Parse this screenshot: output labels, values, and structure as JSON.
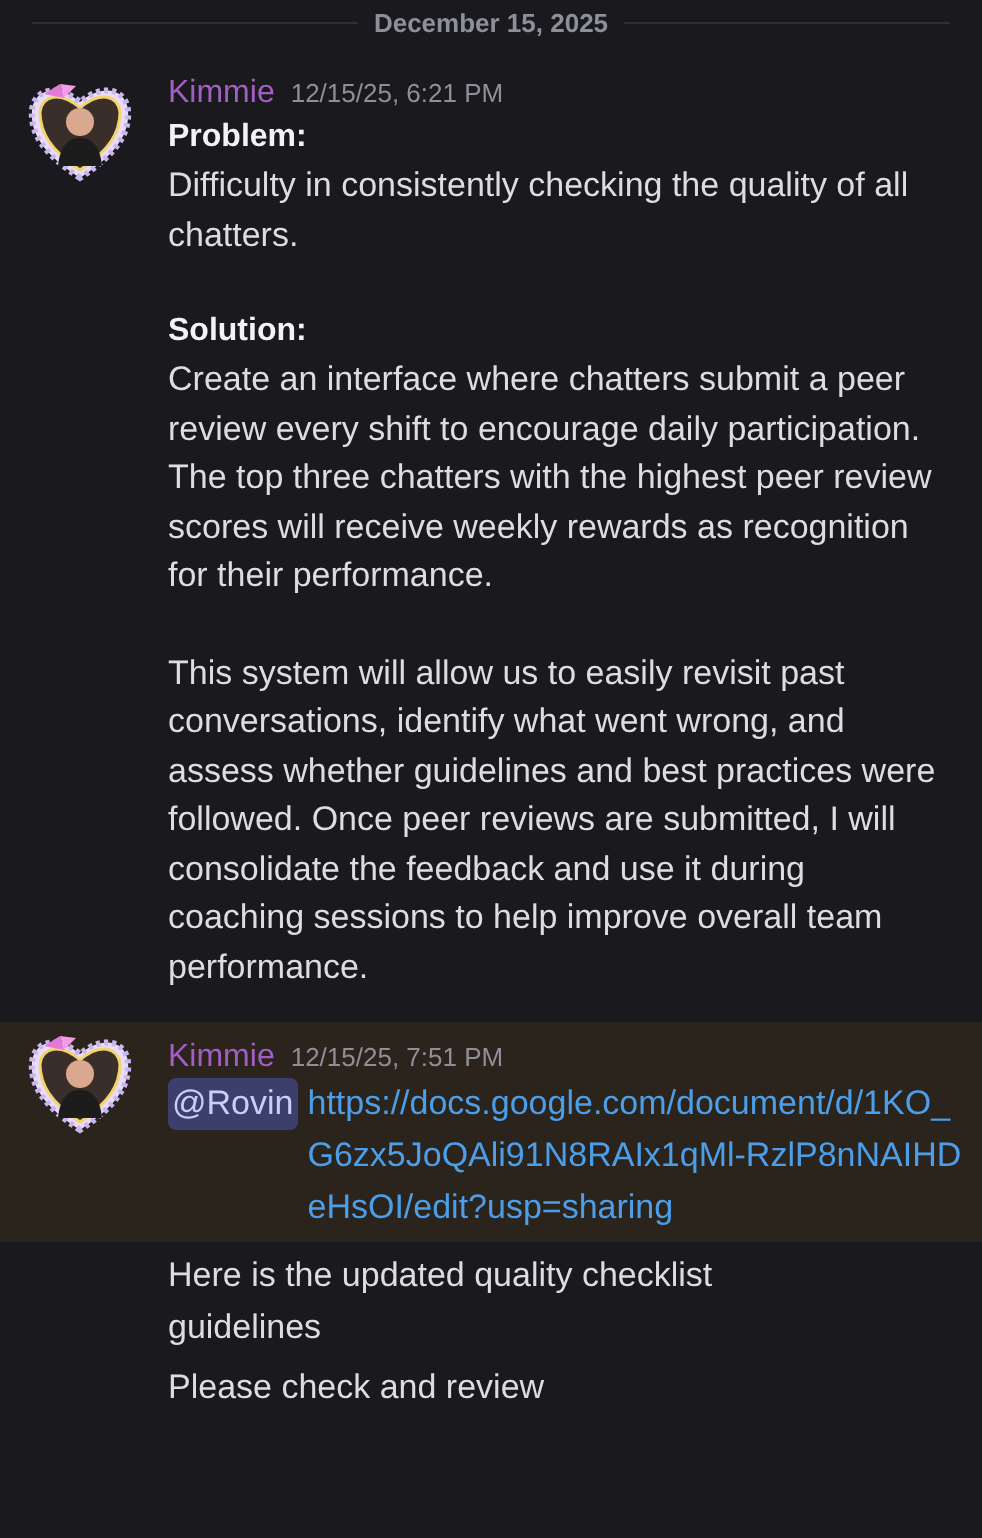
{
  "date_divider": "December 15, 2025",
  "messages": [
    {
      "author": "Kimmie",
      "timestamp": "12/15/25, 6:21 PM",
      "highlighted": false,
      "blocks": [
        {
          "kind": "bold",
          "text": "Problem:"
        },
        {
          "kind": "text",
          "text": "Difficulty in consistently checking the quality of all chatters."
        },
        {
          "kind": "gap"
        },
        {
          "kind": "bold",
          "text": "Solution:"
        },
        {
          "kind": "text",
          "text": "Create an interface where chatters submit a peer review every shift to encourage daily participation. The top three chatters with the highest peer review scores will receive weekly rewards as recognition for their performance."
        },
        {
          "kind": "gap"
        },
        {
          "kind": "text",
          "text": "This system will allow us to easily revisit past conversations, identify what went wrong, and assess whether guidelines and best practices were followed. Once peer reviews are submitted, I will consolidate the feedback and use it during coaching sessions to help improve overall team performance."
        }
      ]
    },
    {
      "author": "Kimmie",
      "timestamp": "12/15/25, 7:51 PM",
      "highlighted": true,
      "blocks": [
        {
          "kind": "link",
          "mention": "@Rovin",
          "text": "https://docs.google.com/document/d/1KO_G6zx5JoQAli91N8RAIx1qMl-RzlP8nNAIHDeHsOI/edit?usp=sharing"
        }
      ],
      "followups": [
        "Here is the updated quality checklist guidelines",
        "Please check and review"
      ]
    }
  ]
}
